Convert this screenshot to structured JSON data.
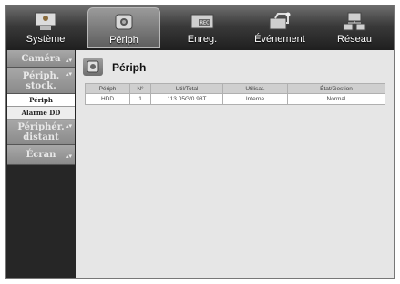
{
  "tabs": [
    {
      "label": "Système",
      "icon": "monitor-icon"
    },
    {
      "label": "Périph",
      "icon": "camera-icon"
    },
    {
      "label": "Enreg.",
      "icon": "rec-icon"
    },
    {
      "label": "Événement",
      "icon": "event-icon"
    },
    {
      "label": "Réseau",
      "icon": "network-icon"
    }
  ],
  "sidebar": {
    "items": [
      {
        "label": "Caméra"
      },
      {
        "label_line1": "Périph.",
        "label_line2": "stock."
      },
      {
        "label_line1": "Périphér.",
        "label_line2": "distant"
      },
      {
        "label": "Écran"
      }
    ],
    "subitems": [
      {
        "label": "Périph"
      },
      {
        "label": "Alarme DD"
      }
    ]
  },
  "main": {
    "title": "Périph",
    "table": {
      "columns": [
        "Périph",
        "N°",
        "Util/Total",
        "Utilisat.",
        "État/Gestion"
      ],
      "rows": [
        [
          "HDD",
          "1",
          "113.05G/0.98T",
          "Interne",
          "Normal"
        ]
      ]
    }
  },
  "colors": {
    "active_tab": "#7d7d7d",
    "topbar": "#2b2b2b",
    "content_bg": "#e6e6e6"
  }
}
